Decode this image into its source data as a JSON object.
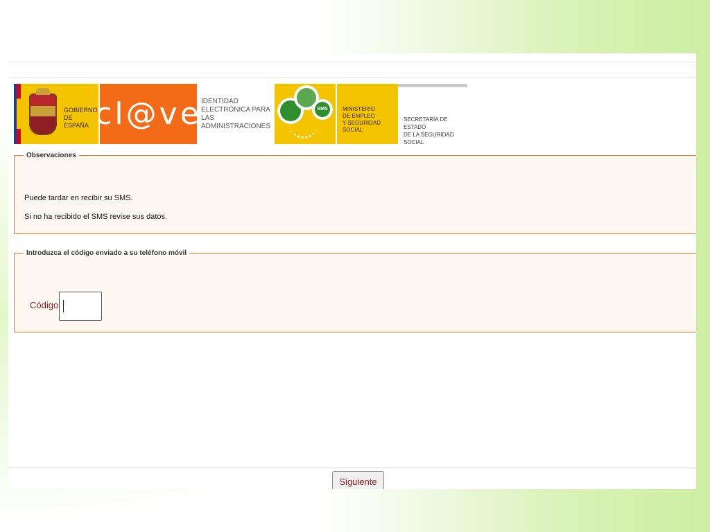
{
  "banner": {
    "gobierno_line1": "Gobierno",
    "gobierno_line2": "de España",
    "clave_logo": "cl@ve",
    "clave_sub_line1": "Identidad",
    "clave_sub_line2": "electrónica para",
    "clave_sub_line3": "las administraciones",
    "sms_badge": "SMS",
    "ministerio_line1": "Ministerio",
    "ministerio_line2": "de Empleo",
    "ministerio_line3": "y Seguridad Social",
    "secretaria_line1": "Secretaría de Estado",
    "secretaria_line2": "de la Seguridad Social"
  },
  "observaciones": {
    "legend": "Observaciones",
    "line1": "Puede tardar en recibir su SMS.",
    "line2": "Si no ha recibido el SMS revise sus datos."
  },
  "codigo": {
    "legend": "Introduzca el código enviado a su teléfono móvil",
    "label": "Código:",
    "value": ""
  },
  "actions": {
    "next_label": "Siguiente"
  },
  "colors": {
    "accent_orange": "#e87a2c",
    "label_red": "#8b1a1a",
    "gov_yellow": "#f5c400",
    "clave_orange": "#f36b16",
    "sms_green": "#2f8f2f"
  }
}
